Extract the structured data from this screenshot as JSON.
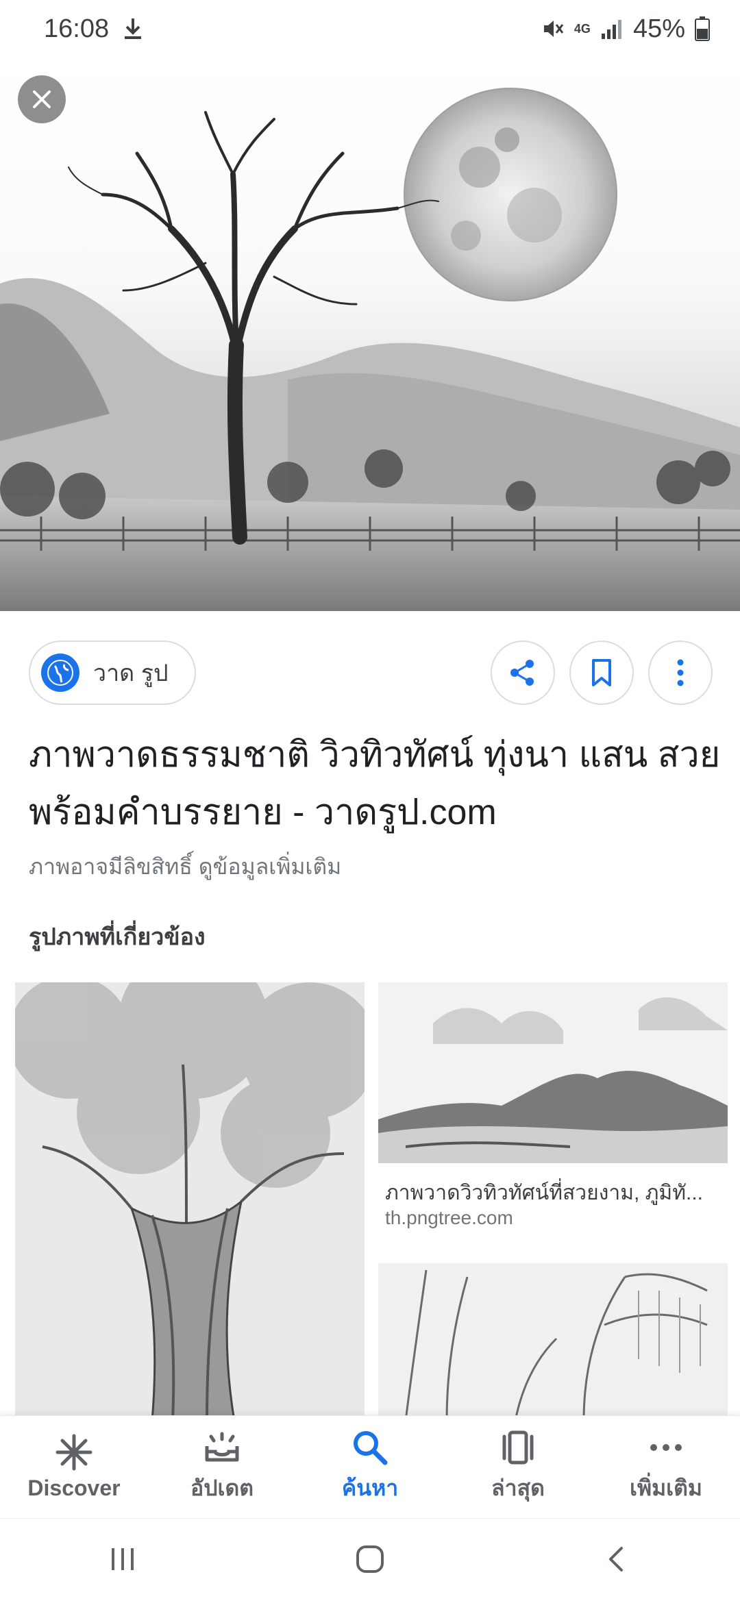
{
  "status_bar": {
    "time": "16:08",
    "network": "4G",
    "battery": "45%",
    "icons": [
      "download-icon",
      "mute-icon",
      "signal-icon",
      "battery-icon"
    ]
  },
  "result": {
    "site_name": "วาด รูป",
    "title": "ภาพวาดธรรมชาติ วิวทิวทัศน์ ทุ่งนา แสน สวย พร้อมคำบรรยาย - วาดรูป.com",
    "copyright_note": "ภาพอาจมีลิขสิทธิ์ ดูข้อมูลเพิ่มเติม"
  },
  "related": {
    "heading": "รูปภาพที่เกี่ยวข้อง",
    "items": [
      {
        "caption": "ภาพวาดวิวทิวทัศน์ที่สวยงาม, ภูมิทั...",
        "source": "th.pngtree.com"
      }
    ]
  },
  "bottom_nav": {
    "items": [
      {
        "label": "Discover",
        "icon": "asterisk-icon",
        "active": false
      },
      {
        "label": "อัปเดต",
        "icon": "updates-tray-icon",
        "active": false
      },
      {
        "label": "ค้นหา",
        "icon": "search-icon",
        "active": true
      },
      {
        "label": "ล่าสุด",
        "icon": "recent-cards-icon",
        "active": false
      },
      {
        "label": "เพิ่มเติม",
        "icon": "more-dots-icon",
        "active": false
      }
    ]
  },
  "colors": {
    "accent": "#1a73e8",
    "text_primary": "#202124",
    "text_secondary": "#70757a"
  }
}
